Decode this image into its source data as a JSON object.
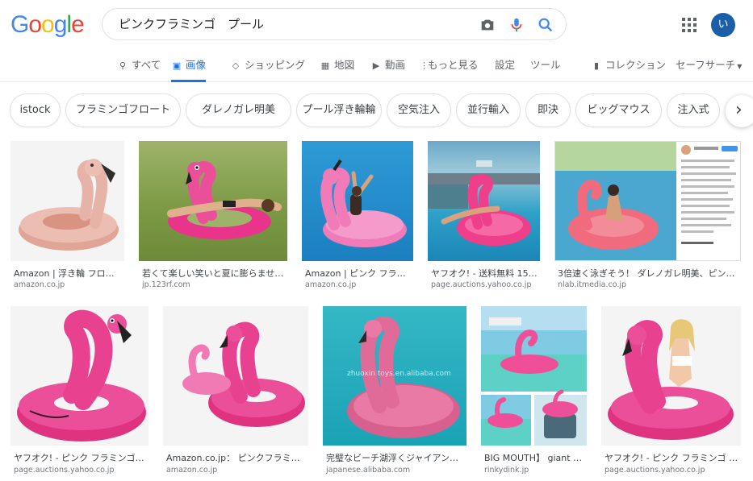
{
  "search": {
    "query": "ピンクフラミンゴ　プール"
  },
  "header": {
    "avatar_letter": "い"
  },
  "tabs": [
    {
      "icon": "search-icon",
      "label": "すべて"
    },
    {
      "icon": "image-icon",
      "label": "画像"
    },
    {
      "icon": "tag-icon",
      "label": "ショッピング"
    },
    {
      "icon": "map-icon",
      "label": "地図"
    },
    {
      "icon": "video-icon",
      "label": "動画"
    },
    {
      "icon": "more-vert-icon",
      "label": "もっと見る"
    },
    {
      "icon": "",
      "label": "設定"
    },
    {
      "icon": "",
      "label": "ツール"
    },
    {
      "icon": "bookmark-icon",
      "label": "コレクション"
    },
    {
      "icon": "",
      "label": "セーフサーチ"
    }
  ],
  "chips": [
    "istock",
    "フラミンゴフロート",
    "ダレノガレ明美",
    "プール浮き輪輪",
    "空気注入",
    "並行輸入",
    "即決",
    "ビッグマウス",
    "注入式"
  ],
  "results": [
    {
      "caption": "Amazon | 浮き輪 フロー…",
      "source": "amazon.co.jp"
    },
    {
      "caption": "若くて楽しい笑いと夏に膨らませ…",
      "source": "jp.123rf.com"
    },
    {
      "caption": "Amazon | ピンク フラミ…",
      "source": "amazon.co.jp"
    },
    {
      "caption": "ヤフオク! - 送料無料 150…",
      "source": "page.auctions.yahoo.co.jp"
    },
    {
      "caption": "3倍速く泳ぎそう！ ダレノガレ明美、ピン…",
      "source": "nlab.itmedia.co.jp"
    },
    {
      "caption": "ヤフオク! - ピンク フラミンゴ …",
      "source": "page.auctions.yahoo.co.jp"
    },
    {
      "caption": "Amazon.co.jp： ピンクフラミン…",
      "source": "amazon.co.jp"
    },
    {
      "caption": "完璧なビーチ湖浮くジャイアン…",
      "source": "japanese.alibaba.com"
    },
    {
      "caption": "BIG MOUTH】 giant pin…",
      "source": "rinkydink.jp"
    },
    {
      "caption": "ヤフオク! - ピンク フラミンゴ …",
      "source": "page.auctions.yahoo.co.jp"
    }
  ],
  "watermark": "zhuoxin toys.en.alibaba.com",
  "colors": {
    "accent": "#1a73e8",
    "flamingo": "#ec4f9a",
    "flamingo_light": "#f7a1c9",
    "rose_gold": "#e6b3a8"
  }
}
